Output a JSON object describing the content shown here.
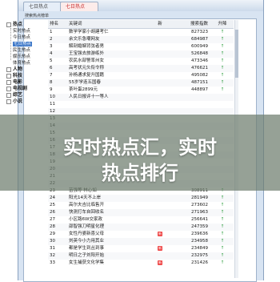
{
  "window": {
    "title": "搜索热点排行",
    "tabs": [
      "七日热点",
      "七日热点"
    ]
  },
  "subtitle": "搜索热点榜单",
  "tree": [
    {
      "label": "热点",
      "level": 0,
      "root": true
    },
    {
      "label": "实时热点",
      "level": 1
    },
    {
      "label": "今日热点",
      "level": 1
    },
    {
      "label": "七日热点",
      "level": 1,
      "selected": true
    },
    {
      "label": "民生热点",
      "level": 1
    },
    {
      "label": "娱乐热点",
      "level": 1
    },
    {
      "label": "体育热点",
      "level": 1
    },
    {
      "label": "人物",
      "level": 0,
      "root": true
    },
    {
      "label": "科技",
      "level": 0,
      "root": true
    },
    {
      "label": "电影",
      "level": 0,
      "root": true
    },
    {
      "label": "电视剧",
      "level": 0,
      "root": true
    },
    {
      "label": "综艺",
      "level": 0,
      "root": true
    },
    {
      "label": "小说",
      "level": 0,
      "root": true
    }
  ],
  "table": {
    "headers": {
      "rank": "排名",
      "keyword": "关键词",
      "new": "新",
      "index": "搜索指数",
      "trend": "升降"
    },
    "rows": [
      {
        "rank": "1",
        "keyword": "数学学家小胡建考仁",
        "new": "",
        "index": "827323",
        "trend": "↑"
      },
      {
        "rank": "2",
        "keyword": "余文乐急嘲网友",
        "new": "",
        "index": "684987",
        "trend": "↑"
      },
      {
        "rank": "3",
        "keyword": "解剖婚姻背弦者男",
        "new": "",
        "index": "600949",
        "trend": "↑"
      },
      {
        "rank": "4",
        "keyword": "王宝强去旅游练外",
        "new": "",
        "index": "526848",
        "trend": "↑"
      },
      {
        "rank": "5",
        "keyword": "农民水部警率州女",
        "new": "",
        "index": "473346",
        "trend": "↑"
      },
      {
        "rank": "6",
        "keyword": "高考状元头衔令称",
        "new": "",
        "index": "476621",
        "trend": "↑"
      },
      {
        "rank": "7",
        "keyword": "孙杨通求复升国籍",
        "new": "",
        "index": "495082",
        "trend": "↑"
      },
      {
        "rank": "8",
        "keyword": "55岁学连五国春",
        "new": "",
        "index": "487151",
        "trend": "↑"
      },
      {
        "rank": "9",
        "keyword": "茶叶蛋2899元",
        "new": "",
        "index": "448897",
        "trend": "↑"
      },
      {
        "rank": "10",
        "keyword": "人民日报评十一等人",
        "new": "",
        "index": "",
        "trend": ""
      },
      {
        "rank": "11",
        "keyword": "",
        "new": "",
        "index": "",
        "trend": ""
      },
      {
        "rank": "12",
        "keyword": "",
        "new": "",
        "index": "",
        "trend": ""
      },
      {
        "rank": "13",
        "keyword": "",
        "new": "",
        "index": "",
        "trend": ""
      },
      {
        "rank": "14",
        "keyword": "",
        "new": "",
        "index": "",
        "trend": ""
      },
      {
        "rank": "15",
        "keyword": "",
        "new": "",
        "index": "",
        "trend": ""
      },
      {
        "rank": "16",
        "keyword": "",
        "new": "",
        "index": "",
        "trend": ""
      },
      {
        "rank": "17",
        "keyword": "",
        "new": "",
        "index": "",
        "trend": ""
      },
      {
        "rank": "18",
        "keyword": "",
        "new": "",
        "index": "",
        "trend": ""
      },
      {
        "rank": "19",
        "keyword": "",
        "new": "",
        "index": "",
        "trend": ""
      },
      {
        "rank": "20",
        "keyword": "",
        "new": "",
        "index": "",
        "trend": ""
      },
      {
        "rank": "21",
        "keyword": "",
        "new": "",
        "index": "",
        "trend": ""
      },
      {
        "rank": "22",
        "keyword": "",
        "new": "",
        "index": "",
        "trend": ""
      },
      {
        "rank": "23",
        "keyword": "苗强等 林心如",
        "new": "",
        "index": "308911",
        "trend": "↑"
      },
      {
        "rank": "24",
        "keyword": "阳光14天不上岸",
        "new": "",
        "index": "281949",
        "trend": "↑"
      },
      {
        "rank": "25",
        "keyword": "高尔夫吉比临售开",
        "new": "",
        "index": "273602",
        "trend": "↑"
      },
      {
        "rank": "26",
        "keyword": "快测打车自回收名",
        "new": "",
        "index": "271963",
        "trend": "↑"
      },
      {
        "rank": "27",
        "keyword": "小区路6W交家政",
        "new": "",
        "index": "256641",
        "trend": "↑"
      },
      {
        "rank": "28",
        "keyword": "邵智强刀明星化理",
        "new": "",
        "index": "247359",
        "trend": "↑"
      },
      {
        "rank": "29",
        "keyword": "女性丹婆新喜父母",
        "new": "新",
        "index": "239636",
        "trend": "↑"
      },
      {
        "rank": "30",
        "keyword": "刘英今小力用其业",
        "new": "",
        "index": "234958",
        "trend": "↑"
      },
      {
        "rank": "31",
        "keyword": "都是学生到丛到事",
        "new": "新",
        "index": "234849",
        "trend": "↑"
      },
      {
        "rank": "32",
        "keyword": "明日之子刘阳开始",
        "new": "",
        "index": "232975",
        "trend": "↑"
      },
      {
        "rank": "33",
        "keyword": "女生捕获文化学集",
        "new": "新",
        "index": "231426",
        "trend": "↑"
      }
    ]
  },
  "banner": {
    "line1": "实时热点汇，实时",
    "line2": "热点排行"
  }
}
